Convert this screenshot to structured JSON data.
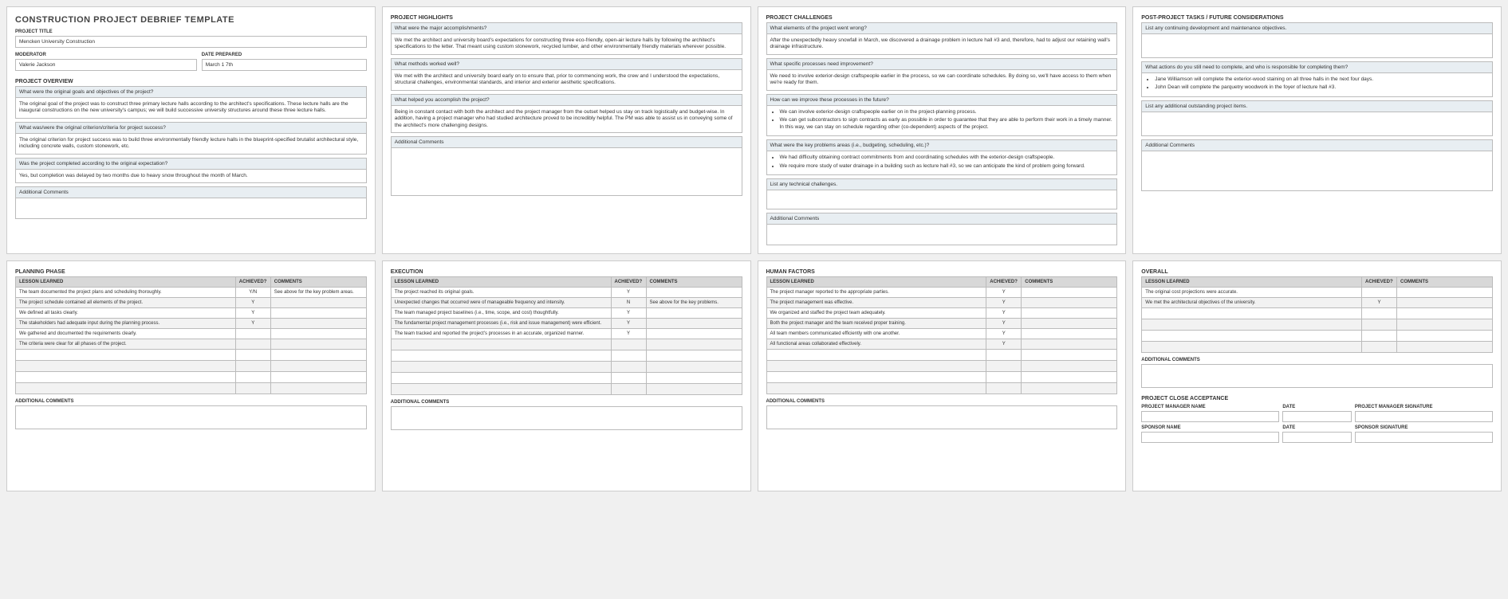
{
  "p1": {
    "title": "CONSTRUCTION PROJECT DEBRIEF TEMPLATE",
    "project_title_label": "PROJECT TITLE",
    "project_title": "Mencken University Construction",
    "moderator_label": "MODERATOR",
    "moderator": "Valerie Jackson",
    "date_label": "DATE PREPARED",
    "date": "March 1 7th",
    "overview_hdr": "PROJECT OVERVIEW",
    "q1": "What were the original goals and objectives of the project?",
    "a1": "The original goal of the project was to construct three primary lecture halls according to the architect's specifications. These lecture halls are the inaugural constructions on the new university's campus; we will build successive university structures around these three lecture halls.",
    "q2": "What was/were the original criterion/criteria for project success?",
    "a2": "The original criterion for project success was to build three environmentally friendly lecture halls in the blueprint-specified brutalist architectural style, including concrete walls, custom stonework, etc.",
    "q3": "Was the project completed according to the original expectation?",
    "a3": "Yes, but completion was delayed by two months due to heavy snow throughout the month of March.",
    "ac": "Additional Comments"
  },
  "p2": {
    "hdr": "PROJECT HIGHLIGHTS",
    "q1": "What were the major accomplishments?",
    "a1": "We met the architect and university board's expectations for constructing three eco-friendly, open-air lecture halls by following the architect's specifications to the letter. That meant using custom stonework, recycled lumber, and other environmentally friendly materials wherever possible.",
    "q2": "What methods worked well?",
    "a2": "We met with the architect and university board early on to ensure that, prior to commencing work, the crew and I understood the expectations, structural challenges, environmental standards, and interior and exterior aesthetic specifications.",
    "q3": "What helped you accomplish the project?",
    "a3": "Being in constant contact with both the architect and the project manager from the outset helped us stay on track logistically and budget-wise. In addition, having a project manager who had studied architecture proved to be incredibly helpful. The PM was able to assist us in conveying some of the architect's more challenging designs.",
    "ac": "Additional Comments"
  },
  "p3": {
    "hdr": "PROJECT CHALLENGES",
    "q1": "What elements of the project went wrong?",
    "a1": "After the unexpectedly heavy snowfall in March, we discovered a drainage problem in lecture hall #3 and, therefore, had to adjust our retaining wall's drainage infrastructure.",
    "q2": "What specific processes need improvement?",
    "a2": "We need to involve exterior-design craftspeople earlier in the process, so we can coordinate schedules. By doing so, we'll have access to them when we're ready for them.",
    "q3": "How can we improve these processes in the future?",
    "a3_items": [
      "We can involve exterior-design craftspeople earlier on in the project-planning process.",
      "We can get subcontractors to sign contracts as early as possible in order to guarantee that they are able to perform their work in a timely manner. In this way, we can stay on schedule regarding other (co-dependent) aspects of the project."
    ],
    "q4": "What were the key problems areas (i.e., budgeting, scheduling, etc.)?",
    "a4_items": [
      "We had difficulty obtaining contract commitments from and coordinating schedules with the exterior-design craftspeople.",
      "We require more study of water drainage in a building such as lecture hall #3, so we can anticipate the kind of problem going forward."
    ],
    "q5": "List any technical challenges.",
    "ac": "Additional Comments"
  },
  "p4": {
    "hdr": "POST-PROJECT TASKS / FUTURE CONSIDERATIONS",
    "q1": "List any continuing development and maintenance objectives.",
    "q2": "What actions do you still need to complete, and who is responsible for completing them?",
    "a2_items": [
      "Jane Williamson will complete the exterior-wood staining on all three halls in the next four days.",
      "John Dean will complete the parquetry woodwork in the foyer of lecture hall #3."
    ],
    "q3": "List any additional outstanding project items.",
    "ac": "Additional Comments"
  },
  "thead": {
    "c1": "LESSON LEARNED",
    "c2": "ACHIEVED?",
    "c3": "COMMENTS"
  },
  "p5": {
    "hdr": "PLANNING PHASE",
    "rows": [
      {
        "c1": "The team documented the project plans and scheduling thoroughly.",
        "c2": "Y/N",
        "c3": "See above for the key problem areas."
      },
      {
        "c1": "The project schedule contained all elements of the project.",
        "c2": "Y",
        "c3": ""
      },
      {
        "c1": "We defined all tasks clearly.",
        "c2": "Y",
        "c3": ""
      },
      {
        "c1": "The stakeholders had adequate input during the planning process.",
        "c2": "Y",
        "c3": ""
      },
      {
        "c1": "We gathered and documented the requirements clearly.",
        "c2": "",
        "c3": ""
      },
      {
        "c1": "The criteria were clear for all phases of the project.",
        "c2": "",
        "c3": ""
      }
    ],
    "ac": "Additional Comments"
  },
  "p6": {
    "hdr": "EXECUTION",
    "rows": [
      {
        "c1": "The project reached its original goals.",
        "c2": "Y",
        "c3": ""
      },
      {
        "c1": "Unexpected changes that occurred were of manageable frequency and intensity.",
        "c2": "N",
        "c3": "See above for the key problems."
      },
      {
        "c1": "The team managed project baselines (i.e., time, scope, and cost) thoughtfully.",
        "c2": "Y",
        "c3": ""
      },
      {
        "c1": "The fundamental project management processes (i.e., risk and issue management) were efficient.",
        "c2": "Y",
        "c3": ""
      },
      {
        "c1": "The team tracked and reported the project's processes in an accurate, organized manner.",
        "c2": "Y",
        "c3": ""
      }
    ],
    "ac": "Additional Comments"
  },
  "p7": {
    "hdr": "HUMAN FACTORS",
    "rows": [
      {
        "c1": "The project manager reported to the appropriate parties.",
        "c2": "Y",
        "c3": ""
      },
      {
        "c1": "The project management was effective.",
        "c2": "Y",
        "c3": ""
      },
      {
        "c1": "We organized and staffed the project team adequately.",
        "c2": "Y",
        "c3": ""
      },
      {
        "c1": "Both the project manager and the team received proper training.",
        "c2": "Y",
        "c3": ""
      },
      {
        "c1": "All team members communicated efficiently with one another.",
        "c2": "Y",
        "c3": ""
      },
      {
        "c1": "All functional areas collaborated effectively.",
        "c2": "Y",
        "c3": ""
      }
    ],
    "ac": "Additional Comments"
  },
  "p8": {
    "hdr": "OVERALL",
    "rows": [
      {
        "c1": "The original cost projections were accurate.",
        "c2": "",
        "c3": ""
      },
      {
        "c1": "We met the architectural objectives of the university.",
        "c2": "Y",
        "c3": ""
      }
    ],
    "ac": "Additional Comments",
    "close_hdr": "PROJECT CLOSE ACCEPTANCE",
    "pm_name": "PROJECT MANAGER NAME",
    "date": "DATE",
    "pm_sig": "PROJECT MANAGER SIGNATURE",
    "sp_name": "SPONSOR NAME",
    "sp_sig": "SPONSOR SIGNATURE"
  }
}
